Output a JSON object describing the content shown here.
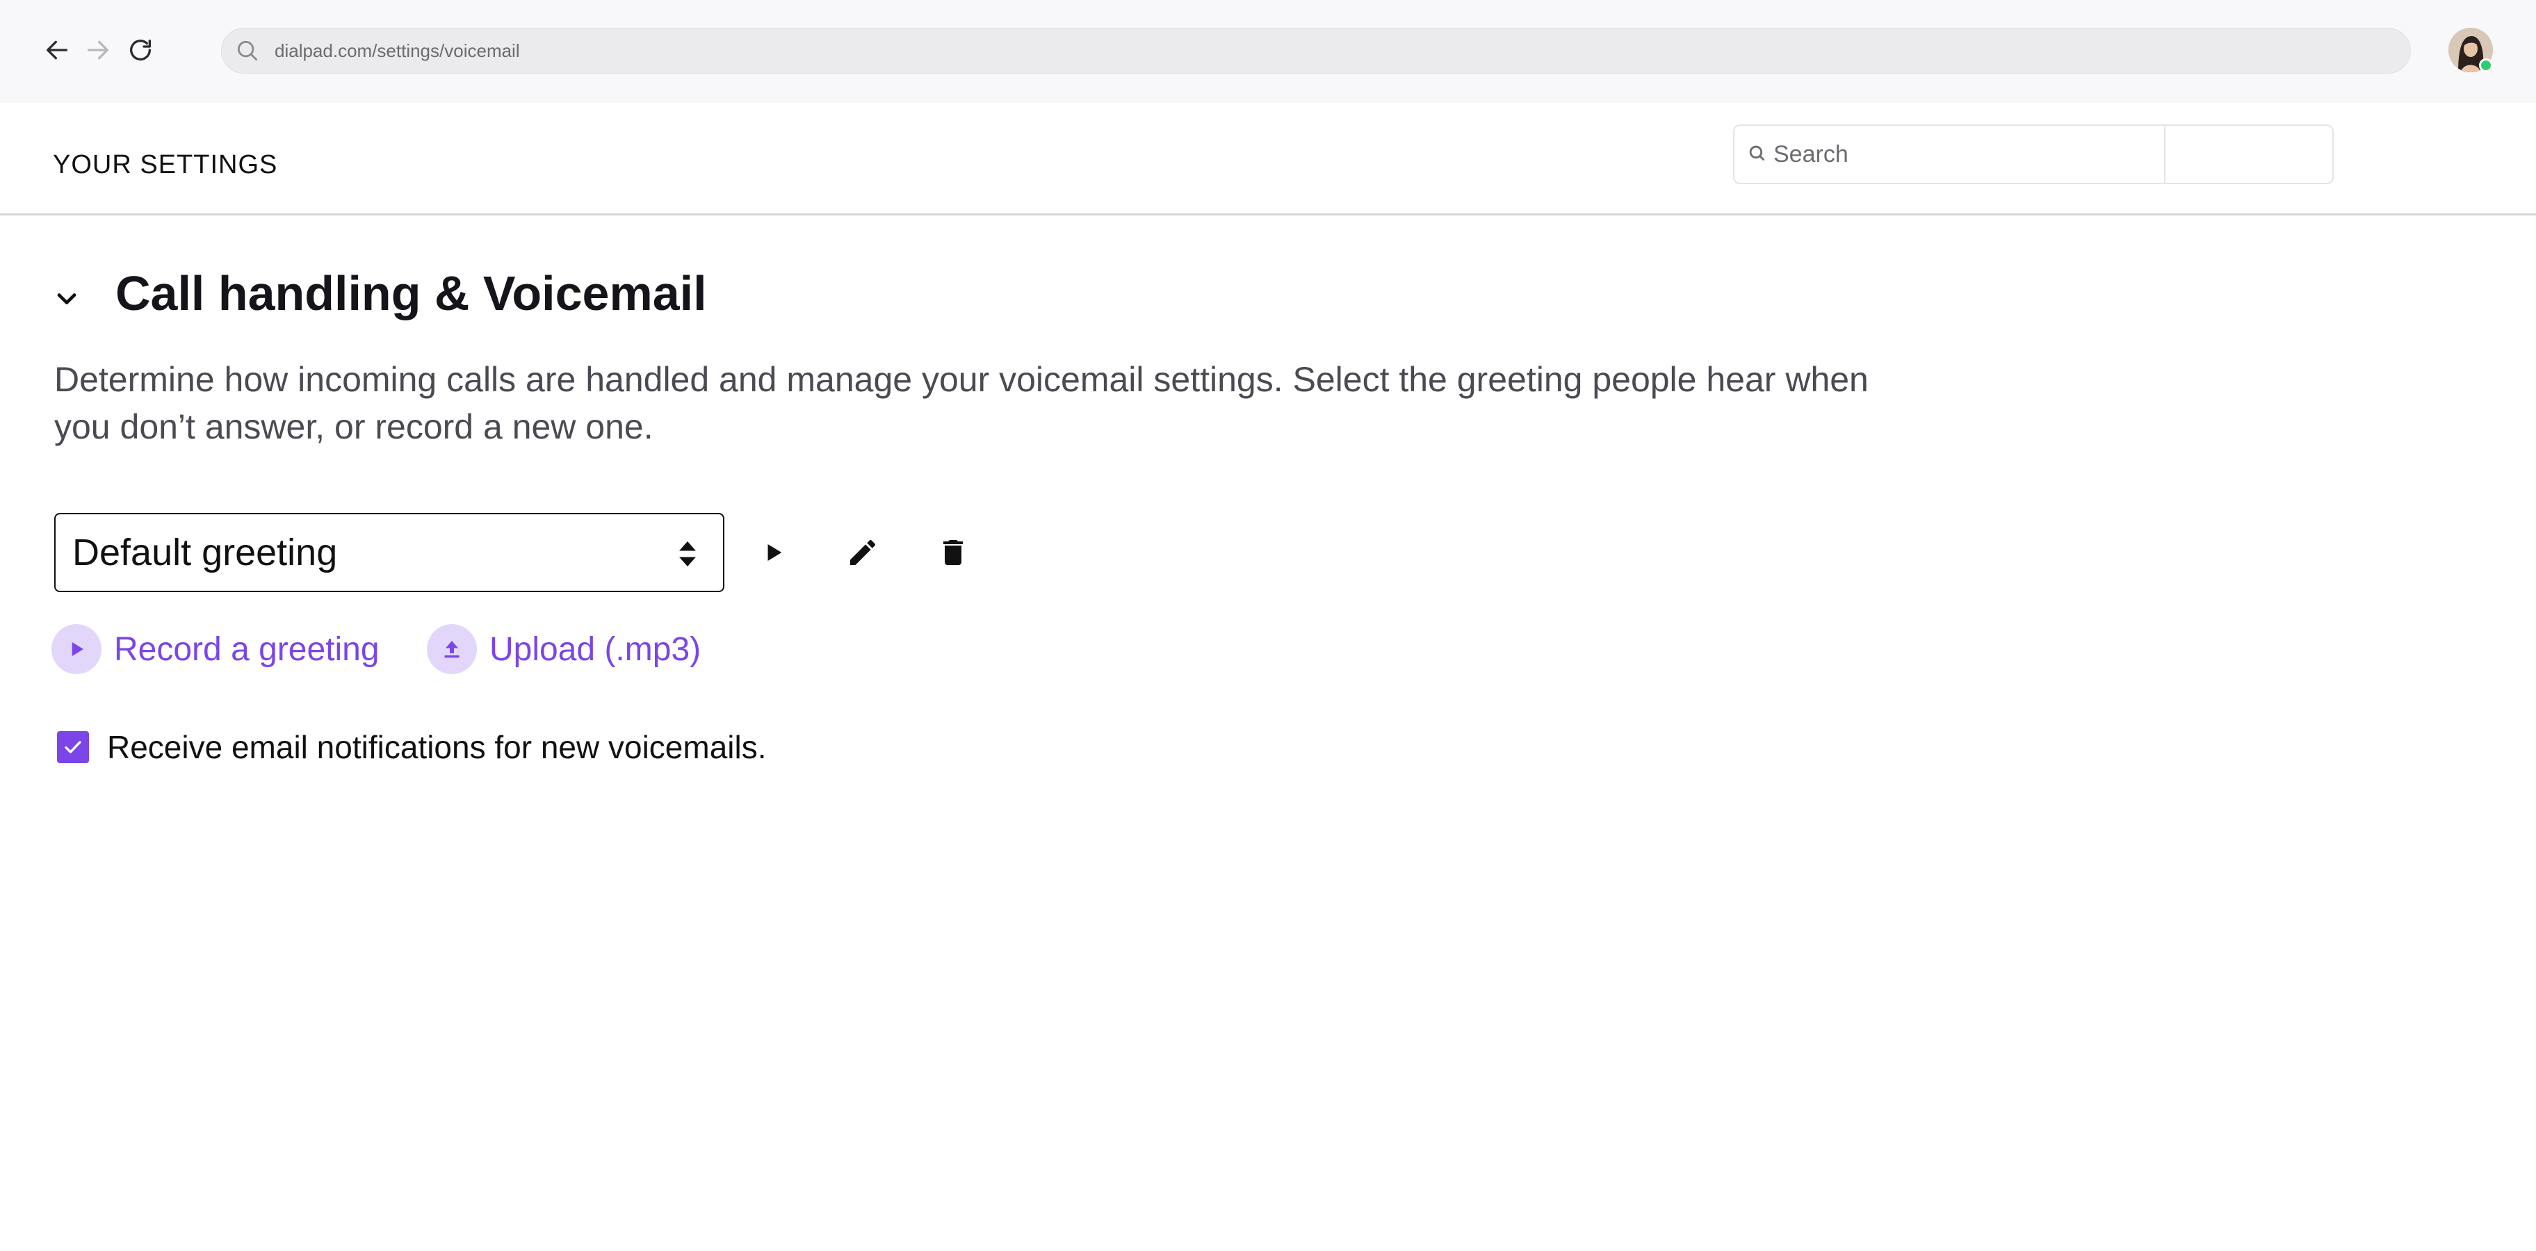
{
  "browser": {
    "url": "dialpad.com/settings/voicemail",
    "icons": [
      "back-arrow-icon",
      "forward-arrow-icon",
      "reload-icon",
      "search-icon",
      "avatar"
    ],
    "status_color": "#2ecc71"
  },
  "header": {
    "title": "YOUR SETTINGS",
    "search_placeholder": "Search"
  },
  "section": {
    "title": "Call handling & Voicemail",
    "description": "Determine how incoming calls are handled and manage your voicemail settings. Select the greeting people hear when you don’t answer, or record a new one.",
    "expanded": true
  },
  "greeting": {
    "selected": "Default greeting",
    "actions": [
      "play",
      "edit",
      "delete"
    ]
  },
  "links": {
    "record": "Record a greeting",
    "upload": "Upload (.mp3)"
  },
  "notifications": {
    "checked": true,
    "label": "Receive email notifications for new voicemails."
  },
  "colors": {
    "accent": "#7b45e8",
    "accent_soft": "#e3d6fb",
    "text": "#111111",
    "muted_text": "#4a4a52"
  }
}
